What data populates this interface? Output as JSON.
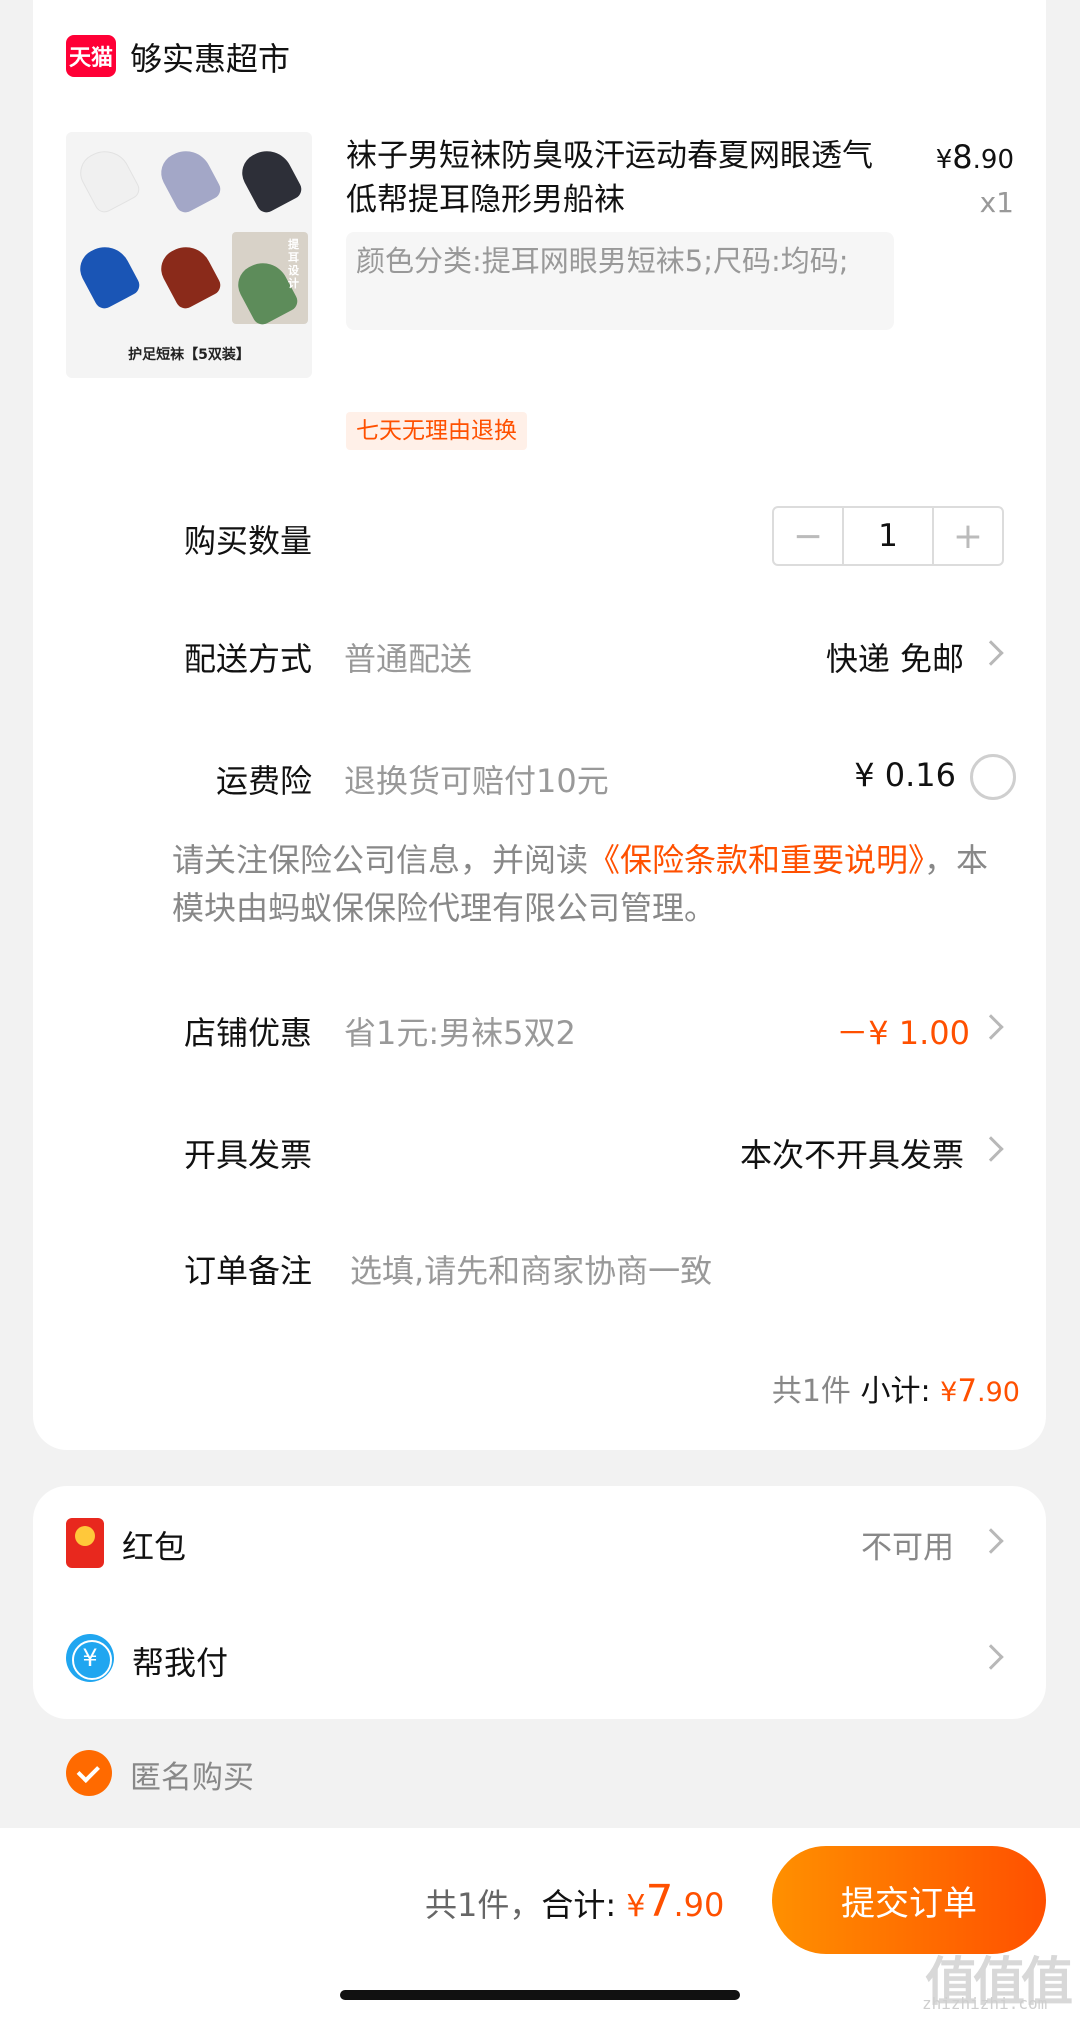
{
  "store": {
    "badge": "天猫",
    "name": "够实惠超市"
  },
  "product": {
    "title": "袜子男短袜防臭吸汗运动春夏网眼透气低帮提耳隐形男船袜",
    "price_symbol": "¥",
    "price_int": "8",
    "price_dec": ".90",
    "quantity_label": "x1",
    "sku": "颜色分类:提耳网眼男短袜5;尺码:均码;",
    "image_caption": "护足短袜【5双装】",
    "image_side_text": "提耳设计",
    "tag": "七天无理由退换"
  },
  "quantity": {
    "label": "购买数量",
    "value": "1",
    "minus": "−",
    "plus": "+"
  },
  "delivery": {
    "label": "配送方式",
    "method": "普通配送",
    "value": "快递 免邮"
  },
  "insurance": {
    "label": "运费险",
    "desc": "退换货可赔付10元",
    "price": "¥ 0.16",
    "notice_pre": "请关注保险公司信息，并阅读",
    "notice_link": "《保险条款和重要说明》",
    "notice_post": "，本模块由蚂蚁保保险代理有限公司管理。"
  },
  "shop_discount": {
    "label": "店铺优惠",
    "desc": "省1元:男袜5双2",
    "value": "－¥ 1.00"
  },
  "invoice": {
    "label": "开具发票",
    "value": "本次不开具发票"
  },
  "remark": {
    "label": "订单备注",
    "placeholder": "选填,请先和商家协商一致"
  },
  "subtotal": {
    "count": "共1件",
    "label": "小计:",
    "symbol": "¥",
    "int": "7",
    "dec": ".90"
  },
  "redpacket": {
    "label": "红包",
    "value": "不可用"
  },
  "helppay": {
    "label": "帮我付",
    "icon_glyph": "¥"
  },
  "anonymous": {
    "label": "匿名购买"
  },
  "footer": {
    "count": "共1件，",
    "total_label": "合计:",
    "symbol": "¥",
    "int": "7",
    "dec": ".90",
    "submit": "提交订单"
  },
  "watermark": {
    "main": "值值值",
    "sub": "zhizhizhi.com"
  },
  "colors": {
    "accent": "#ff5000",
    "tmall": "#ff0036"
  },
  "icons": [
    "tmall-logo-icon",
    "chevron-right-icon",
    "radio-empty-icon",
    "red-packet-icon",
    "yuan-coin-icon",
    "check-circle-icon"
  ]
}
